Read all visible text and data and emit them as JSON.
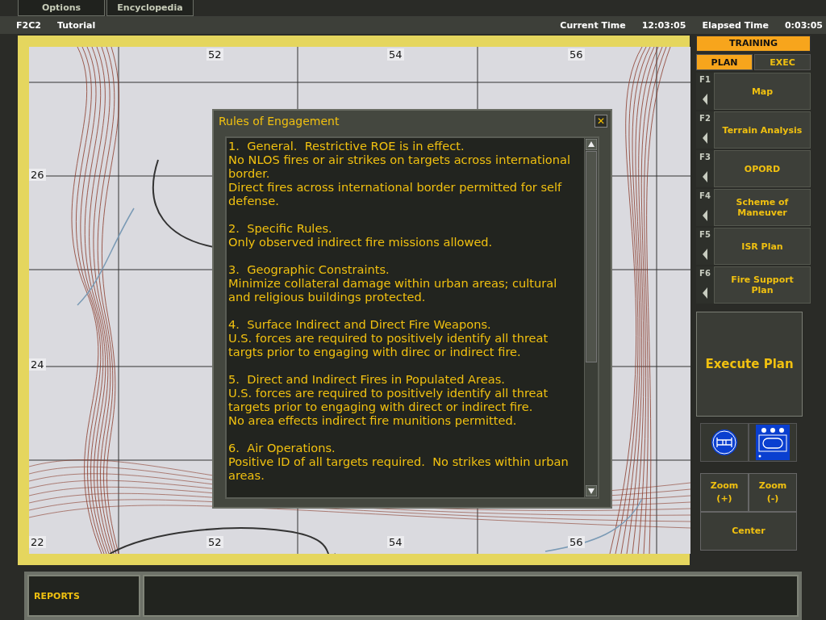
{
  "menu_tabs": [
    "Options",
    "Encyclopedia"
  ],
  "header": {
    "mission_code": "F2C2",
    "mission_name": "Tutorial",
    "current_time_label": "Current Time",
    "current_time": "12:03:05",
    "elapsed_time_label": "Elapsed Time",
    "elapsed_time": "0:03:05"
  },
  "map": {
    "top_labels": [
      "52",
      "54",
      "56"
    ],
    "left_labels": [
      "26",
      "24",
      "22"
    ],
    "bottom_labels": [
      "52",
      "54",
      "56"
    ]
  },
  "dialog": {
    "title": "Rules of Engagement",
    "close": "✕",
    "paragraphs": [
      {
        "lines": [
          "1.  General.  Restrictive ROE is in effect.",
          "No NLOS fires or air strikes on targets across international border.",
          "Direct fires across international border permitted for self defense."
        ]
      },
      {
        "lines": [
          "2.  Specific Rules.",
          "Only observed indirect fire missions allowed."
        ]
      },
      {
        "lines": [
          "3.  Geographic Constraints.",
          "Minimize collateral damage within urban areas; cultural and religious buildings protected."
        ]
      },
      {
        "lines": [
          "4.  Surface Indirect and Direct Fire Weapons.",
          "U.S. forces are required to positively identify all threat targts prior to engaging with direc or indirect fire."
        ]
      },
      {
        "lines": [
          "5.  Direct and Indirect Fires in Populated Areas.",
          "U.S. forces are required to positively identify all threat targets prior to engaging with direct or indirect fire.",
          "No area effects indirect fire munitions permitted."
        ]
      },
      {
        "lines": [
          "6.  Air Operations.",
          "Positive ID of all targets required.  No strikes within urban areas."
        ]
      }
    ]
  },
  "side_panel": {
    "mode": "TRAINING",
    "phase_tabs": [
      {
        "label": "PLAN",
        "selected": true
      },
      {
        "label": "EXEC",
        "selected": false
      }
    ],
    "functions": [
      {
        "key": "F1",
        "label": "Map"
      },
      {
        "key": "F2",
        "label": "Terrain Analysis"
      },
      {
        "key": "F3",
        "label": "OPORD"
      },
      {
        "key": "F4",
        "label": "Scheme of Maneuver"
      },
      {
        "key": "F5",
        "label": "ISR Plan"
      },
      {
        "key": "F6",
        "label": "Fire Support Plan"
      }
    ],
    "execute": "Execute Plan",
    "zoom_in": [
      "Zoom",
      "(+)"
    ],
    "zoom_out": [
      "Zoom",
      "(-)"
    ],
    "center": "Center"
  },
  "bottom": {
    "reports": "REPORTS"
  }
}
